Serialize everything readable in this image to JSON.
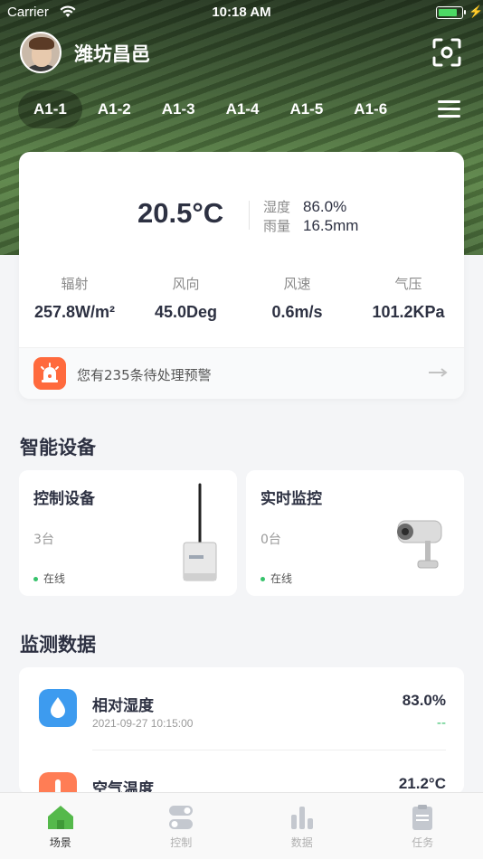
{
  "status_bar": {
    "carrier": "Carrier",
    "time": "10:18 AM"
  },
  "header": {
    "location": "潍坊昌邑"
  },
  "tabs": [
    {
      "label": "A1-1"
    },
    {
      "label": "A1-2"
    },
    {
      "label": "A1-3"
    },
    {
      "label": "A1-4"
    },
    {
      "label": "A1-5"
    },
    {
      "label": "A1-6"
    }
  ],
  "weather": {
    "temperature": "20.5°C",
    "humidity_label": "湿度",
    "humidity_value": "86.0%",
    "rain_label": "雨量",
    "rain_value": "16.5mm",
    "metrics": [
      {
        "label": "辐射",
        "value": "257.8W/m²"
      },
      {
        "label": "风向",
        "value": "45.0Deg"
      },
      {
        "label": "风速",
        "value": "0.6m/s"
      },
      {
        "label": "气压",
        "value": "101.2KPa"
      }
    ],
    "alert_text": "您有235条待处理预警"
  },
  "devices": {
    "title": "智能设备",
    "cards": [
      {
        "title": "控制设备",
        "count": "3台",
        "status": "在线"
      },
      {
        "title": "实时监控",
        "count": "0台",
        "status": "在线"
      }
    ]
  },
  "monitoring": {
    "title": "监测数据",
    "rows": [
      {
        "name": "相对湿度",
        "time": "2021-09-27 10:15:00",
        "value": "83.0%",
        "trend": "--"
      },
      {
        "name": "空气温度",
        "value": "21.2°C"
      }
    ]
  },
  "tabbar": {
    "items": [
      {
        "label": "场景"
      },
      {
        "label": "控制"
      },
      {
        "label": "数据"
      },
      {
        "label": "任务"
      }
    ]
  },
  "colors": {
    "accent_green": "#36c26b",
    "alert_orange": "#ff6a3d",
    "humidity_blue": "#3d9bef",
    "temperature_orange": "#ff7d55"
  }
}
